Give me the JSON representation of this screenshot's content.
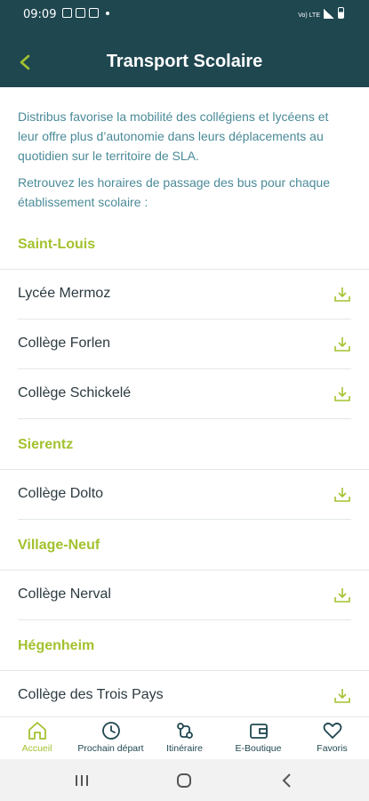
{
  "status_bar": {
    "time": "09:09",
    "network": "Vo) LTE"
  },
  "header": {
    "title": "Transport Scolaire",
    "back_icon": "chevron-left-icon"
  },
  "intro": {
    "paragraph1": "Distribus favorise la mobilité des collégiens et lycéens et leur offre plus d’autonomie dans leurs déplacements au quotidien sur le territoire de SLA.",
    "paragraph2": "Retrouvez les horaires de passage des bus pour chaque établissement scolaire :"
  },
  "sections": [
    {
      "title": "Saint-Louis",
      "schools": [
        "Lycée Mermoz",
        "Collège Forlen",
        "Collège Schickelé"
      ]
    },
    {
      "title": "Sierentz",
      "schools": [
        "Collège Dolto"
      ]
    },
    {
      "title": "Village-Neuf",
      "schools": [
        "Collège Nerval"
      ]
    },
    {
      "title": "Hégenheim",
      "schools": [
        "Collège des Trois Pays"
      ]
    }
  ],
  "bottom_nav": [
    {
      "label": "Accueil",
      "icon": "home-icon",
      "active": true
    },
    {
      "label": "Prochain départ",
      "icon": "clock-icon",
      "active": false
    },
    {
      "label": "Itinéraire",
      "icon": "route-icon",
      "active": false
    },
    {
      "label": "E-Boutique",
      "icon": "wallet-icon",
      "active": false
    },
    {
      "label": "Favoris",
      "icon": "heart-icon",
      "active": false
    }
  ],
  "colors": {
    "header_bg": "#1f4750",
    "accent": "#a3c22f",
    "intro_text": "#4a8a98"
  }
}
